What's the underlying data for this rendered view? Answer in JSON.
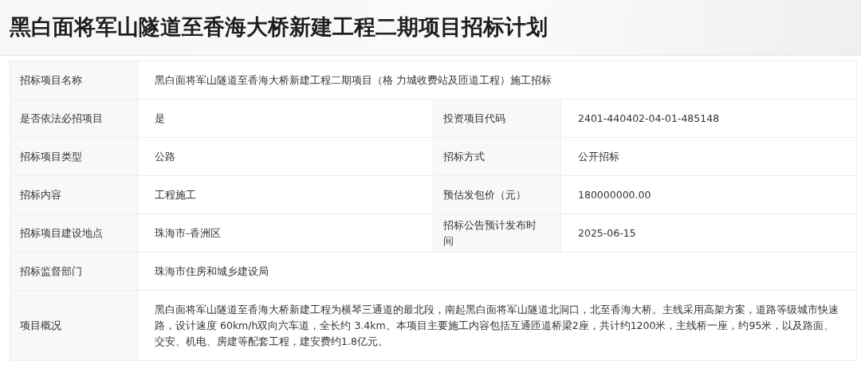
{
  "title": "黑白面将军山隧道至香海大桥新建工程二期项目招标计划",
  "rows": [
    {
      "cells": [
        {
          "label": "招标项目名称",
          "value": "黑白面将军山隧道至香海大桥新建工程二期项目（格 力城收费站及匝道工程）施工招标"
        }
      ]
    },
    {
      "cells": [
        {
          "label": "是否依法必招项目",
          "value": "是"
        },
        {
          "label": "投资项目代码",
          "value": "2401-440402-04-01-485148"
        }
      ]
    },
    {
      "cells": [
        {
          "label": "招标项目类型",
          "value": "公路"
        },
        {
          "label": "招标方式",
          "value": "公开招标"
        }
      ]
    },
    {
      "cells": [
        {
          "label": "招标内容",
          "value": "工程施工"
        },
        {
          "label": "预估发包价（元）",
          "value": "180000000.00"
        }
      ]
    },
    {
      "cells": [
        {
          "label": "招标项目建设地点",
          "value": "珠海市-香洲区"
        },
        {
          "label": "招标公告预计发布时间",
          "value": "2025-06-15"
        }
      ]
    },
    {
      "cells": [
        {
          "label": "招标监督部门",
          "value": "珠海市住房和城乡建设局"
        }
      ]
    },
    {
      "cells": [
        {
          "label": "项目概况",
          "value": "黑白面将军山隧道至香海大桥新建工程为横琴三通道的最北段，南起黑白面将军山隧道北洞口，北至香海大桥。主线采用高架方案，道路等级城市快速路，设计速度 60km/h双向六车道，全长约 3.4km。本项目主要施工内容包括互通匝道桥梁2座，共计约1200米，主线桥一座，约95米，以及路面、交安、机电、房建等配套工程，建安费约1.8亿元。"
        }
      ]
    }
  ]
}
